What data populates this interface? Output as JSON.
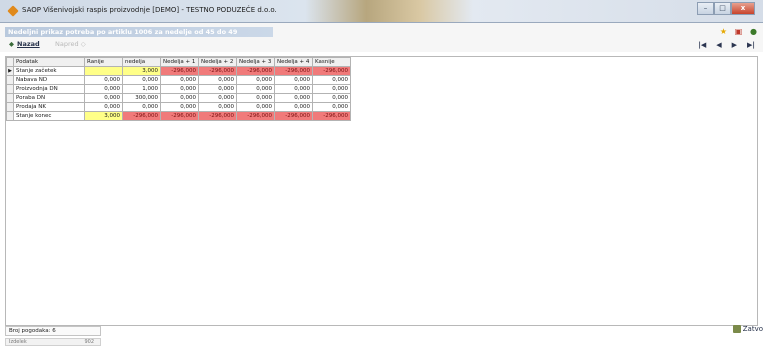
{
  "window": {
    "title": "SAOP  Višenivojski raspis proizvodnje  [DEMO] - TESTNO PODUZEĆE d.o.o.",
    "minimize": "–",
    "maximize": "□",
    "close": "x"
  },
  "header": {
    "form_title": "Nedeljni prikaz potreba po artiklu 1006 za nedelje  od 45  do 49",
    "back_label": "Nazad",
    "forward_label": "Napred"
  },
  "icons": {
    "back": "arrow-left-icon",
    "forward": "arrow-right-icon",
    "favorite": "star-icon",
    "document": "document-icon",
    "pager": [
      "first-page-icon",
      "prev-page-icon",
      "next-page-icon",
      "last-page-icon"
    ]
  },
  "pager": {
    "first": "|◀",
    "prev": "◀",
    "next": "▶",
    "last": "▶|"
  },
  "colors": {
    "highlight_yellow": "#ffff88",
    "negative_red": "#f07a7a"
  },
  "table": {
    "columns": [
      "Podatak",
      "Ranije",
      "nedelja",
      "Nedelja + 1",
      "Nedelja + 2",
      "Nedelja + 3",
      "Nedelja + 4",
      "Kasnije"
    ],
    "rows": [
      {
        "cells": [
          "Stanje začetek",
          "",
          "3,000",
          "-296,000",
          "-296,000",
          "-296,000",
          "-296,000",
          "-296,000"
        ]
      },
      {
        "cells": [
          "Nabava ND",
          "0,000",
          "0,000",
          "0,000",
          "0,000",
          "0,000",
          "0,000",
          "0,000"
        ]
      },
      {
        "cells": [
          "Proizvodnja DN",
          "0,000",
          "1,000",
          "0,000",
          "0,000",
          "0,000",
          "0,000",
          "0,000"
        ]
      },
      {
        "cells": [
          "Poraba DN",
          "0,000",
          "300,000",
          "0,000",
          "0,000",
          "0,000",
          "0,000",
          "0,000"
        ]
      },
      {
        "cells": [
          "Prodaja NK",
          "0,000",
          "0,000",
          "0,000",
          "0,000",
          "0,000",
          "0,000",
          "0,000"
        ]
      },
      {
        "cells": [
          "Stanje konec",
          "3,000",
          "-296,000",
          "-296,000",
          "-296,000",
          "-296,000",
          "-296,000",
          "-296,000"
        ]
      }
    ]
  },
  "status": {
    "count_label": "Broj pogodaka: 6",
    "bottom_left": "Izdelek",
    "bottom_value": "902"
  },
  "footer": {
    "close_label": "Zatvo"
  }
}
